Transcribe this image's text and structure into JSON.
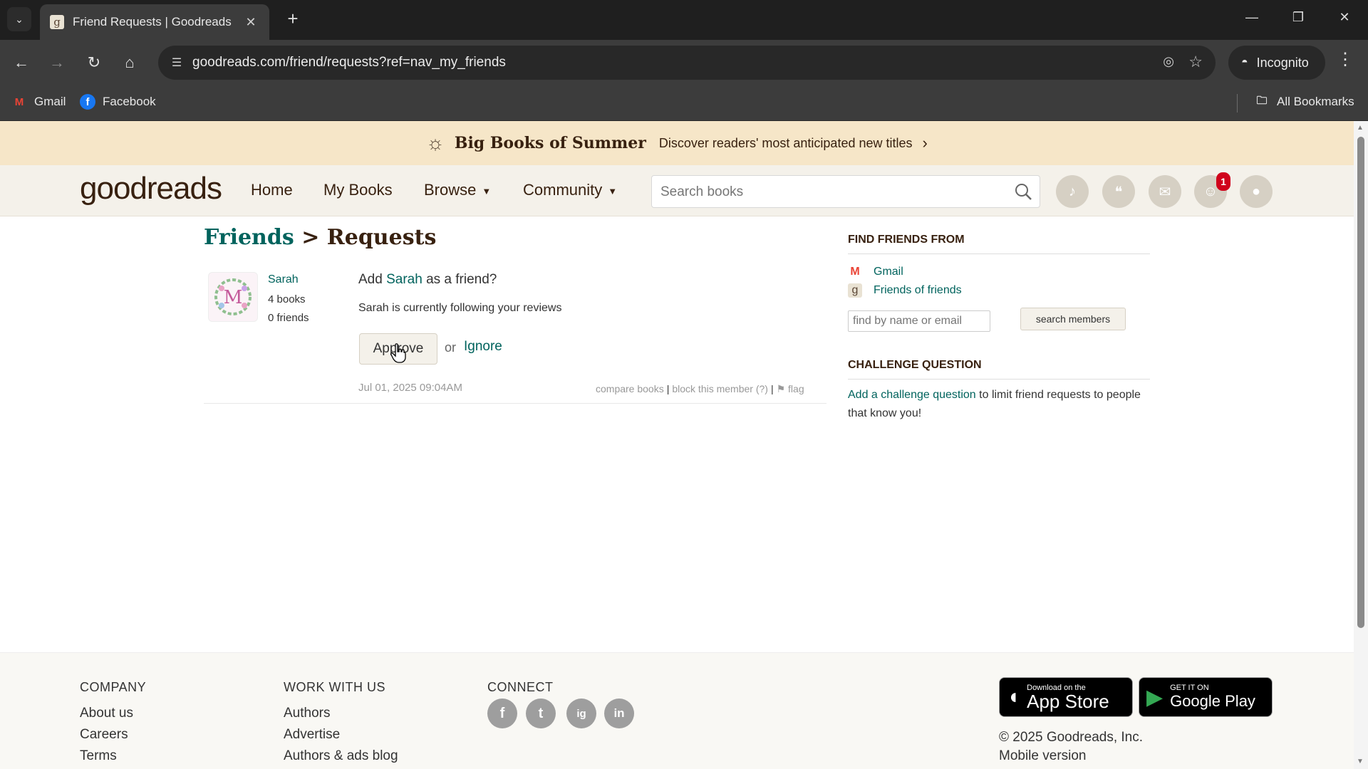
{
  "browser": {
    "tab_title": "Friend Requests | Goodreads",
    "url": "goodreads.com/friend/requests?ref=nav_my_friends",
    "profile_label": "Incognito",
    "bookmarks": [
      "Gmail",
      "Facebook"
    ],
    "all_bookmarks_label": "All Bookmarks"
  },
  "promo": {
    "title": "Big Books of Summer",
    "text": "Discover readers' most anticipated new titles"
  },
  "header": {
    "logo": "goodreads",
    "nav": [
      "Home",
      "My Books",
      "Browse",
      "Community"
    ],
    "search_placeholder": "Search books",
    "friends_badge": "1"
  },
  "breadcrumb": {
    "parent": "Friends",
    "separator": ">",
    "current": "Requests"
  },
  "request": {
    "name": "Sarah",
    "avatar_letter": "M",
    "books": "4 books",
    "friends": "0 friends",
    "question_prefix": "Add",
    "question_suffix": "as a friend?",
    "note": "Sarah is currently following your reviews",
    "approve_label": "Approve",
    "or_label": "or",
    "ignore_label": "Ignore",
    "date": "Jul 01, 2025 09:04AM",
    "compare_books": "compare books",
    "block_member": "block this member (?)",
    "flag": "flag"
  },
  "sidebar": {
    "find_friends_title": "FIND FRIENDS FROM",
    "sources": [
      "Gmail",
      "Friends of friends"
    ],
    "find_placeholder": "find by name or email",
    "search_members_label": "search members",
    "challenge_title": "CHALLENGE QUESTION",
    "challenge_link": "Add a challenge question",
    "challenge_text": "to limit friend requests to people that know you!"
  },
  "footer": {
    "company_title": "COMPANY",
    "company_links": [
      "About us",
      "Careers",
      "Terms"
    ],
    "work_title": "WORK WITH US",
    "work_links": [
      "Authors",
      "Advertise",
      "Authors & ads blog"
    ],
    "connect_title": "CONNECT",
    "social": [
      "f",
      "t",
      "ig",
      "in"
    ],
    "app_store_small": "Download on the",
    "app_store_big": "App Store",
    "google_play_small": "GET IT ON",
    "google_play_big": "Google Play",
    "copyright": "© 2025 Goodreads, Inc.",
    "mobile_version": "Mobile version"
  },
  "colors": {
    "brand_text": "#382110",
    "link": "#00635d",
    "header_bg": "#f4f1ea",
    "promo_bg": "#f6e6c8",
    "badge": "#d0021b"
  }
}
